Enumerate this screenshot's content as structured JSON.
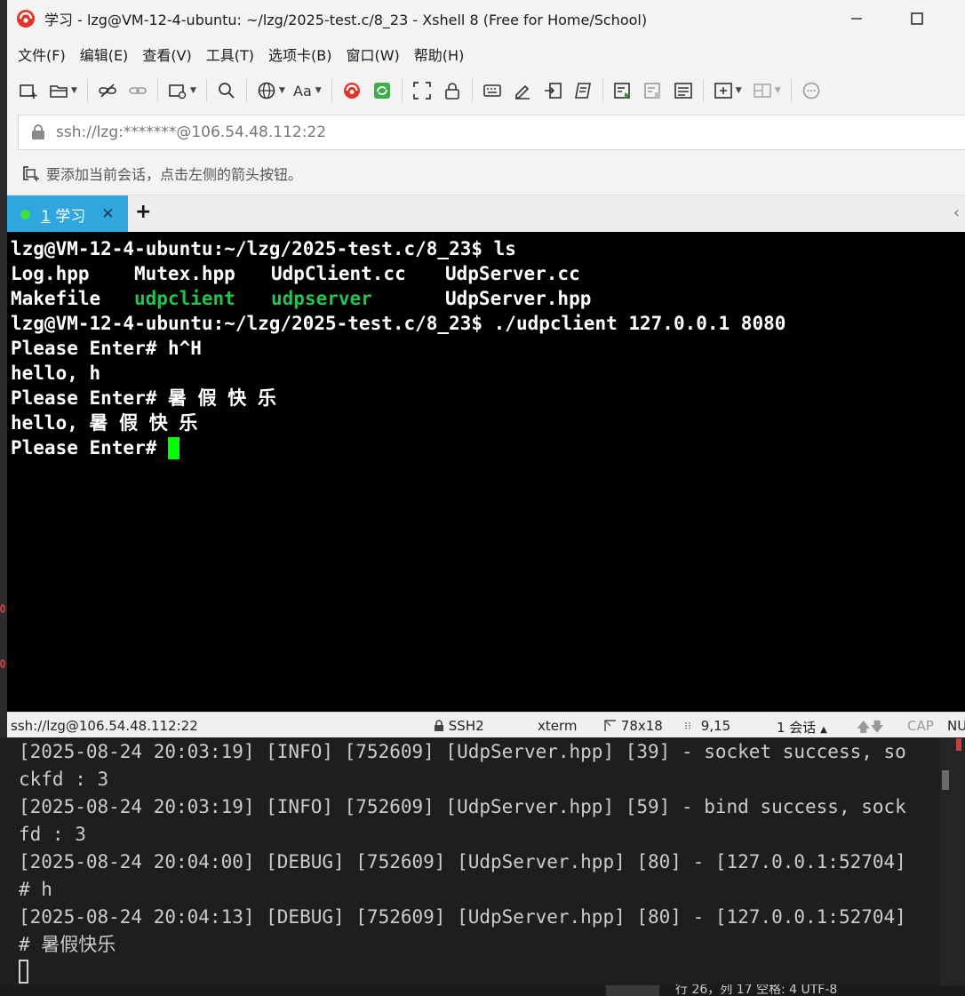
{
  "window": {
    "title": "学习 - lzg@VM-12-4-ubuntu: ~/lzg/2025-test.c/8_23 - Xshell 8 (Free for Home/School)",
    "brand_color": "#e0362c"
  },
  "menu": [
    "文件(F)",
    "编辑(E)",
    "查看(V)",
    "工具(T)",
    "选项卡(B)",
    "窗口(W)",
    "帮助(H)"
  ],
  "toolbar": {
    "font_label": "Aa"
  },
  "address": {
    "value": "ssh://lzg:*******@106.54.48.112:22"
  },
  "hint": {
    "text": "要添加当前会话，点击左侧的箭头按钮。"
  },
  "tabs": [
    {
      "number": "1",
      "label": "学习",
      "status_color": "#3ee03e"
    }
  ],
  "terminal": {
    "prompt": "lzg@VM-12-4-ubuntu:~/lzg/2025-test.c/8_23$ ",
    "cmd1": "ls",
    "ls_row1": [
      "Log.hpp",
      "Mutex.hpp",
      "UdpClient.cc",
      "UdpServer.cc"
    ],
    "ls_row2": [
      "Makefile",
      "udpclient",
      "udpserver",
      "UdpServer.hpp"
    ],
    "cmd2": "./udpclient 127.0.0.1 8080",
    "lines": [
      "Please Enter# h^H",
      "hello, h",
      "Please Enter# 暑 假 快 乐",
      "hello, 暑 假 快 乐"
    ],
    "last_prompt": "Please Enter# "
  },
  "status": {
    "connection": "ssh://lzg@106.54.48.112:22",
    "protocol": "SSH2",
    "term_type": "xterm",
    "size": "78x18",
    "cursor_pos": "9,15",
    "sessions": "1 会话",
    "cap": "CAP",
    "num": "NU"
  },
  "log": {
    "lines": [
      "[2025-08-24 20:03:19] [INFO] [752609] [UdpServer.hpp] [39] - socket success, so",
      "ckfd : 3",
      "[2025-08-24 20:03:19] [INFO] [752609] [UdpServer.hpp] [59] - bind success, sock",
      "fd : 3",
      "[2025-08-24 20:04:00] [DEBUG] [752609] [UdpServer.hpp] [80] - [127.0.0.1:52704]",
      "# h",
      "[2025-08-24 20:04:13] [DEBUG] [752609] [UdpServer.hpp] [80] - [127.0.0.1:52704]",
      "# 暑假快乐"
    ],
    "bottom_status": "行 26，列 17   空格: 4   UTF-8"
  }
}
